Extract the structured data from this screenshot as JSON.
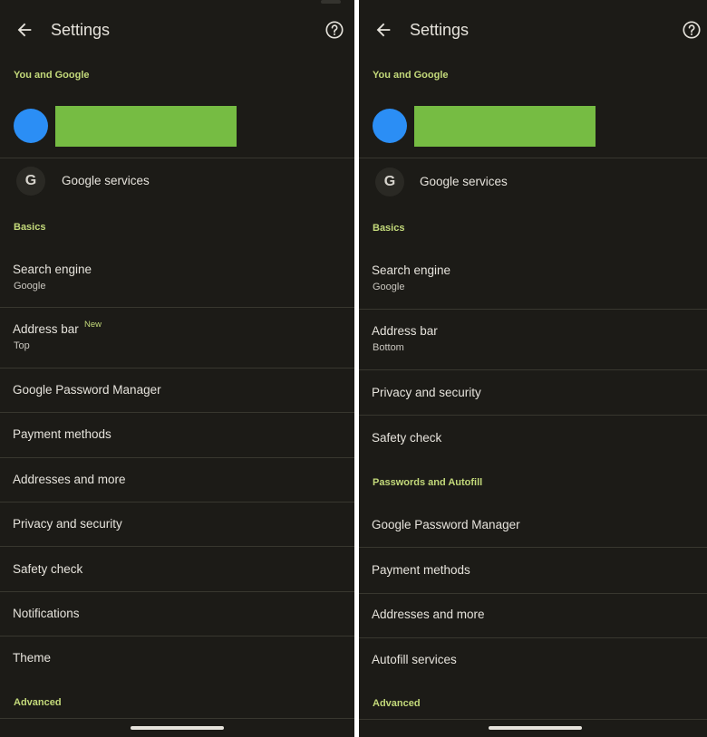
{
  "left": {
    "header": {
      "title": "Settings"
    },
    "sections": {
      "you_and_google": "You and Google",
      "basics": "Basics",
      "advanced": "Advanced"
    },
    "google_services": "Google services",
    "search_engine": {
      "title": "Search engine",
      "value": "Google"
    },
    "address_bar": {
      "title": "Address bar",
      "badge": "New",
      "value": "Top"
    },
    "items": {
      "password_manager": "Google Password Manager",
      "payment_methods": "Payment methods",
      "addresses": "Addresses and more",
      "privacy": "Privacy and security",
      "safety_check": "Safety check",
      "notifications": "Notifications",
      "theme": "Theme"
    }
  },
  "right": {
    "header": {
      "title": "Settings"
    },
    "sections": {
      "you_and_google": "You and Google",
      "basics": "Basics",
      "passwords_autofill": "Passwords and Autofill",
      "advanced": "Advanced"
    },
    "google_services": "Google services",
    "search_engine": {
      "title": "Search engine",
      "value": "Google"
    },
    "address_bar": {
      "title": "Address bar",
      "value": "Bottom"
    },
    "items": {
      "privacy": "Privacy and security",
      "safety_check": "Safety check",
      "password_manager": "Google Password Manager",
      "payment_methods": "Payment methods",
      "addresses": "Addresses and more",
      "autofill_services": "Autofill services"
    }
  },
  "icons": {
    "back": "arrow-left-icon",
    "help": "help-circle-icon",
    "google": "google-g-icon"
  },
  "colors": {
    "background": "#1c1b17",
    "accent": "#c3d97a",
    "avatar": "#2b8ef5",
    "redaction": "#76bc43",
    "text": "#e6e3dc"
  }
}
